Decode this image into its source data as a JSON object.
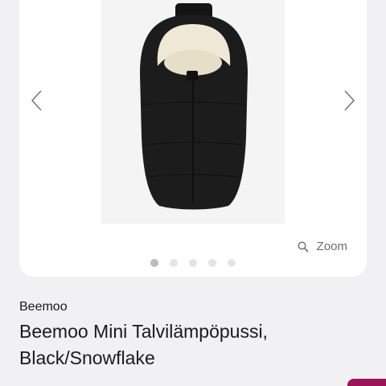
{
  "gallery": {
    "slide_count": 5,
    "active_slide": 1,
    "zoom_label": "Zoom",
    "prev_icon": "chevron-left-icon",
    "next_icon": "chevron-right-icon",
    "zoom_icon": "magnifier-icon"
  },
  "product": {
    "brand": "Beemoo",
    "title": "Beemoo Mini Talvilämpöpussi, Black/Snowflake"
  },
  "colors": {
    "background": "#f1f1f3",
    "card": "#ffffff",
    "accent": "#9c1357",
    "bag": "#1c1c1c",
    "lining": "#efe8d4"
  }
}
